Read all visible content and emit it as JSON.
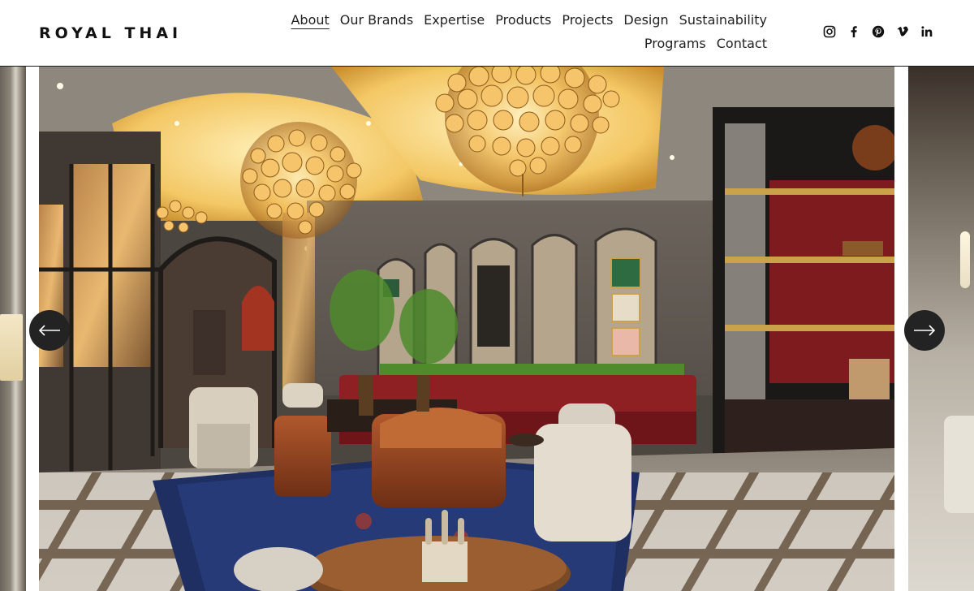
{
  "brand": {
    "name": "ROYAL THAI"
  },
  "nav": {
    "items": [
      {
        "label": "About",
        "active": true
      },
      {
        "label": "Our Brands",
        "active": false
      },
      {
        "label": "Expertise",
        "active": false
      },
      {
        "label": "Products",
        "active": false
      },
      {
        "label": "Projects",
        "active": false
      },
      {
        "label": "Design",
        "active": false
      },
      {
        "label": "Sustainability",
        "active": false
      },
      {
        "label": "Programs",
        "active": false
      },
      {
        "label": "Contact",
        "active": false
      }
    ]
  },
  "social": [
    "instagram-icon",
    "facebook-icon",
    "pinterest-icon",
    "vimeo-icon",
    "linkedin-icon"
  ],
  "slideshow": {
    "prev_icon": "arrow-left-icon",
    "next_icon": "arrow-right-icon"
  },
  "colors": {
    "header_bg": "#ffffff",
    "text": "#111111",
    "arrow_bg": "#232323",
    "accent_gold": "#e8b45a",
    "accent_red": "#8e1f22"
  }
}
